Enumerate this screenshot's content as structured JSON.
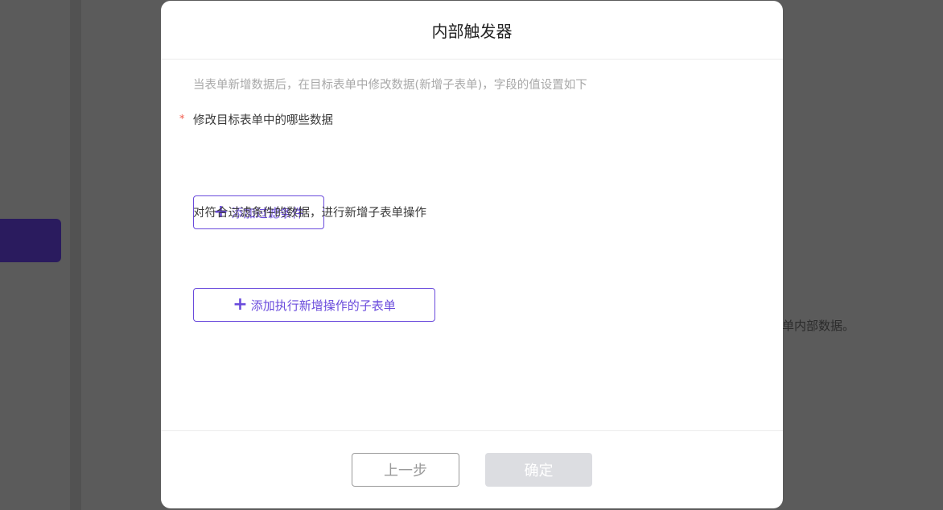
{
  "background": {
    "partial_text": "单内部数据。"
  },
  "modal": {
    "title": "内部触发器",
    "description": "当表单新增数据后，在目标表单中修改数据(新增子表单)，字段的值设置如下",
    "section1": {
      "required_mark": "*",
      "label": "修改目标表单中的哪些数据",
      "button_icon": "+",
      "button_label": "添加过滤条件"
    },
    "section2": {
      "label": "对符合过滤条件的数据，进行新增子表单操作",
      "button_icon": "+",
      "button_label": "添加执行新增操作的子表单"
    },
    "footer": {
      "prev_label": "上一步",
      "ok_label": "确定"
    }
  },
  "colors": {
    "accent": "#6a4bdc",
    "required": "#f05a4b",
    "disabled_button": "#dcdde1",
    "overlay": "#5b5b5b"
  }
}
